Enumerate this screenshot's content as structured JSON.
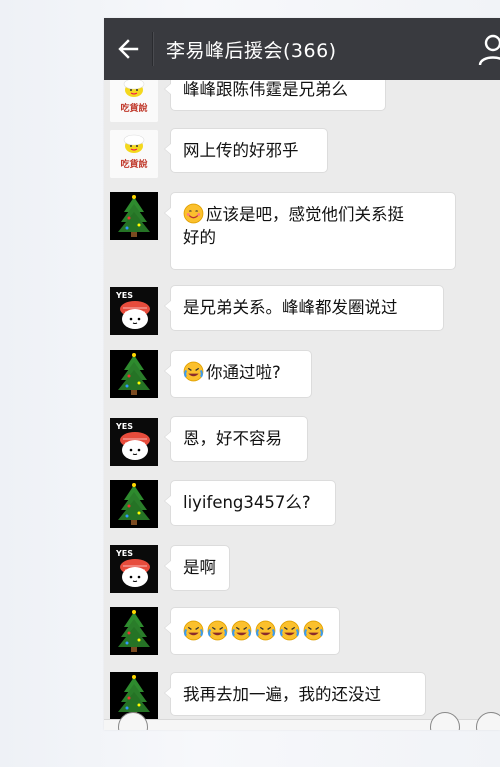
{
  "header": {
    "title": "李易峰后援会(366)",
    "back_icon": "arrow-left-icon",
    "group_icon": "person-icon",
    "background": "#393a3f"
  },
  "messages": [
    {
      "avatar": "chi-huo-shuo",
      "avatar_text": "吃貨說",
      "text": "峰峰跟陈伟霆是兄弟么"
    },
    {
      "avatar": "chi-huo-shuo",
      "avatar_text": "吃貨說",
      "text": "网上传的好邪乎"
    },
    {
      "avatar": "christmas-tree",
      "line1": "应该是吧，感觉他们关系挺",
      "line2": "好的",
      "emoji": "smile-emoji"
    },
    {
      "avatar": "yes-sushi",
      "avatar_text": "YES",
      "text": "是兄弟关系。峰峰都发圈说过"
    },
    {
      "avatar": "christmas-tree",
      "text": "你通过啦?",
      "emoji": "laugh-cry-emoji"
    },
    {
      "avatar": "yes-sushi",
      "avatar_text": "YES",
      "text": "恩，好不容易"
    },
    {
      "avatar": "christmas-tree",
      "text": "liyifeng3457么?"
    },
    {
      "avatar": "yes-sushi",
      "avatar_text": "YES",
      "text": "是啊"
    },
    {
      "avatar": "christmas-tree",
      "emoji": "laugh-cry-emoji",
      "emoji_count": 6
    },
    {
      "avatar": "christmas-tree",
      "text": "我再去加一遍，我的还没过"
    }
  ],
  "colors": {
    "chat_background": "#ebebeb",
    "bubble": "#ffffff",
    "header": "#393a3f"
  }
}
